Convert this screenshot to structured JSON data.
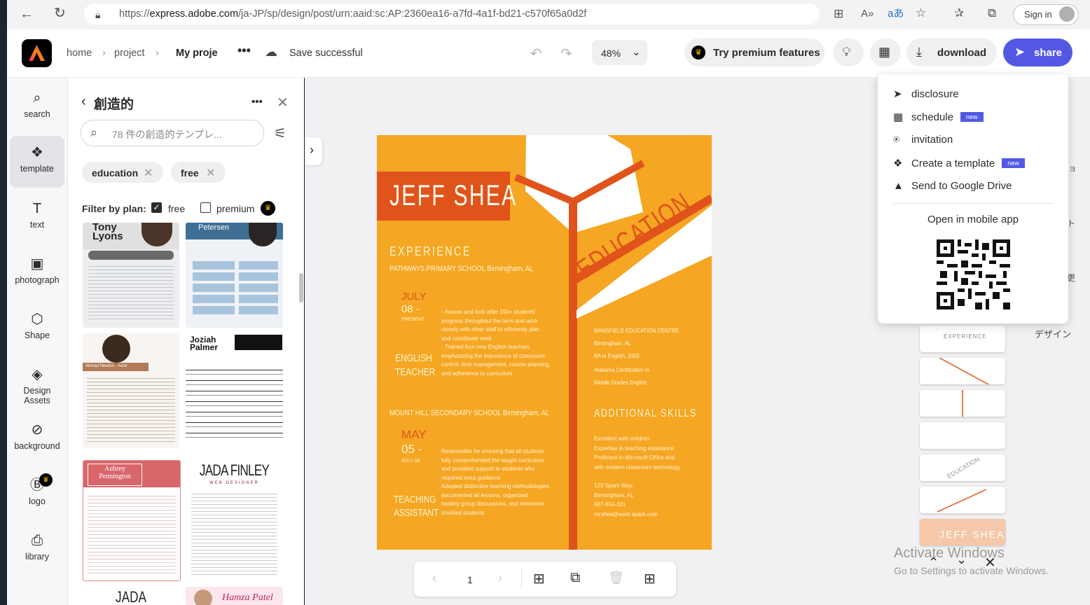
{
  "browser": {
    "url_prefix": "https://",
    "url_domain": "express.adobe.com",
    "url_path": "/ja-JP/sp/design/post/urn:aaid:sc:AP:2360ea16-a7fd-4a1f-bd21-c570f65a0d2f",
    "signin_label": "Sign in"
  },
  "header": {
    "breadcrumb": [
      "home",
      "project",
      "My proje"
    ],
    "save_status": "Save successful",
    "zoom": "48%",
    "premium_label": "Try premium features",
    "download_label": "download",
    "share_label": "share"
  },
  "rail": {
    "items": [
      "search",
      "template",
      "text",
      "photograph",
      "Shape",
      "Design Assets",
      "background",
      "logo",
      "library"
    ]
  },
  "panel": {
    "title": "創造的",
    "search_placeholder": "78 件の創造的テンプレ...",
    "chips": [
      "education",
      "free"
    ],
    "filter_label": "Filter by plan:",
    "filter_free": "free",
    "filter_premium": "premium",
    "thumbs": {
      "t1": "Tony Lyons",
      "t2": "Petersen",
      "t3": "Ahmad Newton - Actor",
      "t4": "Joziah Palmer",
      "t5": "Aubrey Pennington",
      "t6": "JADA FINLEY",
      "t6sub": "WEB DESIGNER",
      "t7": "JADA FINLEY",
      "t8": "Hamza Patel"
    }
  },
  "poster": {
    "name": "JEFF SHEA",
    "education": "EDUCATION",
    "experience": "EXPERIENCE",
    "school1": "PATHWAYS PRIMARY SCHOOL Birmingham, AL",
    "date1a": "JULY",
    "date1b": "08 -",
    "date1c": "PRESENT",
    "role1a": "ENGLISH",
    "role1b": "TEACHER",
    "desc1": [
      "- Assess and look after 150+ students'",
      "progress throughout the term and work",
      "closely with other staff to efficiently plan",
      "and coordinate work",
      "- Trained four new English teachers,",
      "emphasizing the importance of classroom",
      "control, time management, course planning,",
      "and adherence to curriculum"
    ],
    "school2": "MOUNT HILL SECONDARY SCHOOL Birmingham, AL",
    "date2a": "MAY",
    "date2b": "05 -",
    "date2c": "JULY 08",
    "role2a": "TEACHING",
    "role2b": "ASSISTANT",
    "desc2": [
      "Responsible for ensuring that all students",
      "fully comprehended the taught curriculum",
      "and provided support to students who",
      "required extra guidance",
      "Adopted distinctive teaching methodologies,",
      "documented all lessons, organized",
      "healthy group discussions, and mentored",
      "troubled students"
    ],
    "edu_lines": [
      "MANSFIELD EDUCATION CENTRE",
      "Birmingham, AL",
      "BA in English, 2005",
      "Alabama Certification in",
      "Middle Grades English"
    ],
    "skills_title": "ADDITIONAL SKILLS",
    "skills": [
      "Excellent with children",
      "Expertise in teaching assistance",
      "Proficient in Microsoft Office and",
      "with modern classroom technology"
    ],
    "contact": [
      "123 Spark Way,",
      "Birmingham, AL",
      "987-654-321",
      "mrshea@work.spark.com"
    ]
  },
  "bottombar": {
    "page": "1"
  },
  "share_menu": {
    "items": [
      "disclosure",
      "schedule",
      "invitation",
      "Create a template",
      "Send to Google Drive"
    ],
    "new_badge": "new",
    "mobile_label": "Open in mobile app"
  },
  "side_thumbs": {
    "t1": "EXPERIENCE",
    "t5": "EDUCATION",
    "t7": "JEFF SHEA"
  },
  "side_text": {
    "design": "デザイン"
  },
  "watermark": {
    "line1": "Activate Windows",
    "line2": "Go to Settings to activate Windows."
  },
  "colors": {
    "accent": "#5258e4",
    "poster_orange": "#f5a623",
    "poster_red": "#e0531b"
  }
}
